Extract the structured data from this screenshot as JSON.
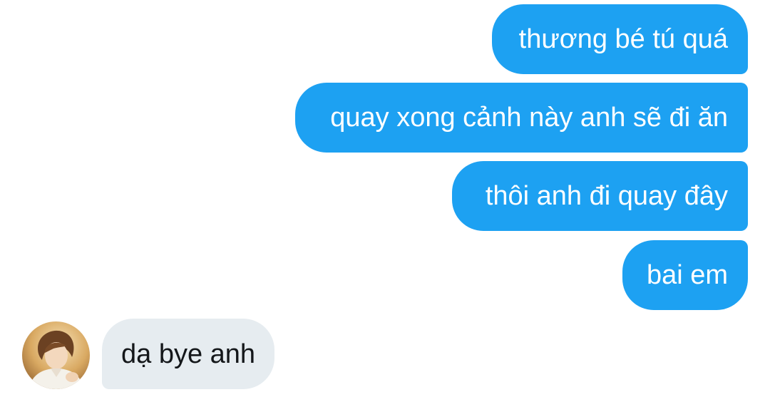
{
  "conversation": {
    "sent_messages": [
      "thương bé tú quá",
      "quay xong cảnh này anh sẽ đi ăn",
      "thôi anh đi quay đây",
      "bai em"
    ],
    "received_message": "dạ bye anh",
    "avatar_icon": "user-avatar-photo"
  },
  "colors": {
    "sent_bubble": "#1da1f2",
    "received_bubble": "#e6ecf0",
    "sent_text": "#ffffff",
    "received_text": "#14171a"
  }
}
